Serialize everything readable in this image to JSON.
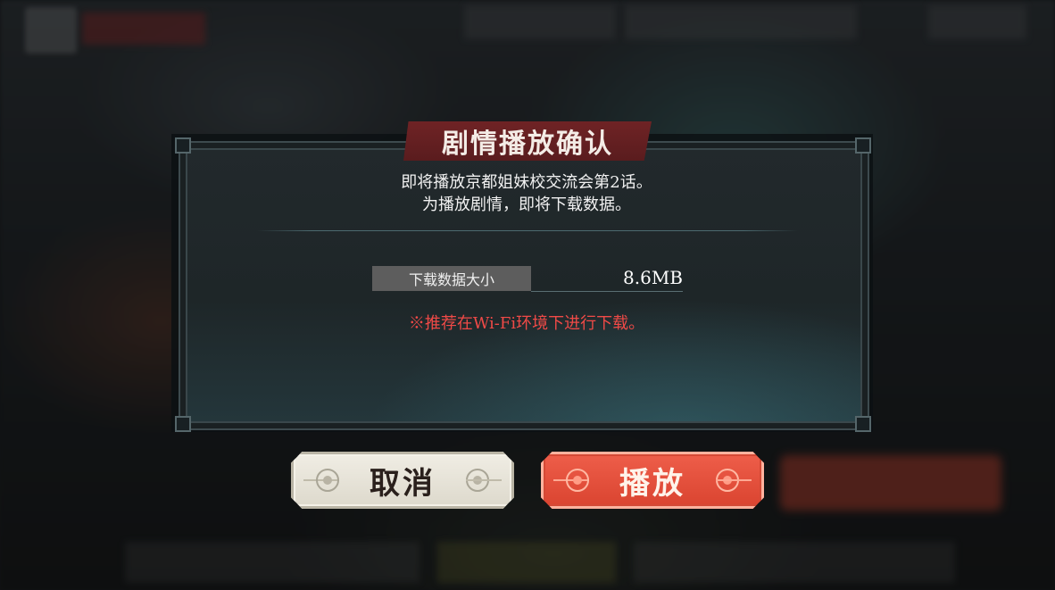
{
  "dialog": {
    "title": "剧情播放确认",
    "message_line1": "即将播放京都姐妹校交流会第2话。",
    "message_line2": "为播放剧情，即将下载数据。",
    "download_size_label": "下载数据大小",
    "download_size_value": "8.6MB",
    "wifi_note": "※推荐在Wi-Fi环境下进行下载。"
  },
  "buttons": {
    "cancel_label": "取消",
    "play_label": "播放"
  },
  "colors": {
    "title_plate": "#6f2325",
    "play_button": "#e34f3a",
    "cancel_button": "#ece8dd",
    "warning_text": "#f04a47"
  }
}
